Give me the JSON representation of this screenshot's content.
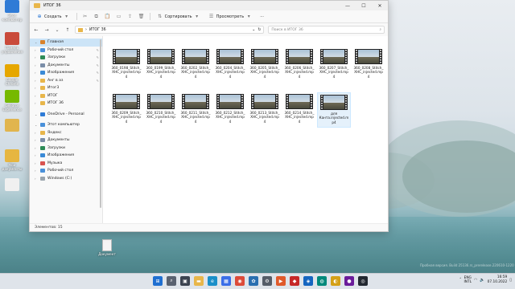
{
  "desktop": {
    "icons": [
      {
        "label": "Этот компьютер",
        "color": "#2f7bd6"
      },
      {
        "label": "Панель управления",
        "color": "#c94a3b"
      },
      {
        "label": "Google Chrome",
        "color": "#e6a700"
      },
      {
        "label": "GeForce Experience",
        "color": "#76b900"
      },
      {
        "label": "",
        "color": "#e1b54e"
      },
      {
        "label": "Мои документы",
        "color": "#e6b640"
      },
      {
        "label": "",
        "color": "#f0f0f0"
      }
    ],
    "doc_label": "Документ"
  },
  "window": {
    "title": "ИТОГ 36",
    "controls": {
      "minimize": "—",
      "maximize": "☐",
      "close": "✕"
    },
    "ribbon": {
      "create_label": "Создать",
      "sort_label": "Сортировать",
      "view_label": "Просмотреть",
      "more_label": "···"
    },
    "address": {
      "path": "ИТОГ 36",
      "search_placeholder": "Поиск в ИТОГ 36"
    },
    "sidebar": {
      "items": [
        {
          "label": "Главная",
          "icon_color": "#d9822b",
          "selected": true,
          "pin": false
        },
        {
          "label": "Рабочий стол",
          "icon_color": "#4a90d9",
          "selected": false,
          "pin": true
        },
        {
          "label": "Загрузки",
          "icon_color": "#2e8b57",
          "selected": false,
          "pin": true
        },
        {
          "label": "Документы",
          "icon_color": "#7b8ea8",
          "selected": false,
          "pin": true
        },
        {
          "label": "Изображения",
          "icon_color": "#3a8ad6",
          "selected": false,
          "pin": true
        },
        {
          "label": "Анг в аз",
          "icon_color": "#e8b64a",
          "selected": false,
          "pin": true
        },
        {
          "label": "Итог3",
          "icon_color": "#e8b64a",
          "selected": false,
          "pin": false
        },
        {
          "label": "ИТОГ",
          "icon_color": "#e8b64a",
          "selected": false,
          "pin": false
        },
        {
          "label": "ИТОГ 36",
          "icon_color": "#e8b64a",
          "selected": false,
          "pin": false
        },
        {
          "label": "",
          "icon_color": "",
          "selected": false,
          "pin": false
        },
        {
          "label": "OneDrive - Personal",
          "icon_color": "#2f7bd6",
          "selected": false,
          "pin": false
        },
        {
          "label": "",
          "icon_color": "",
          "selected": false,
          "pin": false
        },
        {
          "label": "Этот компьютер",
          "icon_color": "#4a90d9",
          "selected": false,
          "pin": false
        },
        {
          "label": "Яндекс",
          "icon_color": "#e8b64a",
          "selected": false,
          "pin": false
        },
        {
          "label": "Документы",
          "icon_color": "#7b8ea8",
          "selected": false,
          "pin": false
        },
        {
          "label": "Загрузки",
          "icon_color": "#2e8b57",
          "selected": false,
          "pin": false
        },
        {
          "label": "Изображения",
          "icon_color": "#3a8ad6",
          "selected": false,
          "pin": false
        },
        {
          "label": "Музыка",
          "icon_color": "#d9534f",
          "selected": false,
          "pin": false
        },
        {
          "label": "Рабочий стол",
          "icon_color": "#4a90d9",
          "selected": false,
          "pin": false
        },
        {
          "label": "Windows (C:)",
          "icon_color": "#9aa4ad",
          "selected": false,
          "pin": false
        }
      ]
    },
    "files": [
      {
        "line1": "360_0198_Stitch_",
        "line2": "XHC_injected.mp",
        "line3": "4"
      },
      {
        "line1": "360_0199_Stitch_",
        "line2": "XHC_injected.mp",
        "line3": "4"
      },
      {
        "line1": "360_0202_Stitch_",
        "line2": "XHC_injected.mp",
        "line3": "4"
      },
      {
        "line1": "360_0204_Stitch_",
        "line2": "XHC_injected.mp",
        "line3": "4"
      },
      {
        "line1": "360_0205_Stitch_",
        "line2": "XHC_injected.mp",
        "line3": "4"
      },
      {
        "line1": "360_0206_Stitch_",
        "line2": "XHC_injected.mp",
        "line3": "4"
      },
      {
        "line1": "360_0207_Stitch_",
        "line2": "XHC_injected.mp",
        "line3": "4"
      },
      {
        "line1": "360_0208_Stitch_",
        "line2": "XHC_injected.mp",
        "line3": "4"
      },
      {
        "line1": "360_0209_Stitch_",
        "line2": "XHC_injected.mp",
        "line3": "4"
      },
      {
        "line1": "360_0210_Stitch_",
        "line2": "XHC_injected.mp",
        "line3": "4"
      },
      {
        "line1": "360_0211_Stitch_",
        "line2": "XHC_injected.mp",
        "line3": "4"
      },
      {
        "line1": "360_0212_Stitch_",
        "line2": "XHC_injected.mp",
        "line3": "4"
      },
      {
        "line1": "360_0213_Stitch_",
        "line2": "XHC_injected.mp",
        "line3": "4"
      },
      {
        "line1": "360_0214_Stitch_",
        "line2": "XHC_injected.mp",
        "line3": "4"
      },
      {
        "line1": "для",
        "line2": "Канта.injected.m",
        "line3": "p4"
      }
    ],
    "status": "Элементов: 15"
  },
  "taskbar": {
    "apps": [
      {
        "name": "start-button",
        "glyph": "⊞",
        "color": "#1f6fd1"
      },
      {
        "name": "search-button",
        "glyph": "⌕",
        "color": "#5a6270"
      },
      {
        "name": "task-view-button",
        "glyph": "▣",
        "color": "#3b4350"
      },
      {
        "name": "explorer-app",
        "glyph": "▬",
        "color": "#e8b64a"
      },
      {
        "name": "edge-app",
        "glyph": "e",
        "color": "#1a8fc9"
      },
      {
        "name": "store-app",
        "glyph": "▦",
        "color": "#3a6ee8"
      },
      {
        "name": "chrome-app",
        "glyph": "◉",
        "color": "#dd4b39"
      },
      {
        "name": "photos-app",
        "glyph": "✿",
        "color": "#2a6fb0"
      },
      {
        "name": "settings-app",
        "glyph": "⚙",
        "color": "#555d68"
      },
      {
        "name": "media-app",
        "glyph": "▶",
        "color": "#e05a2b"
      },
      {
        "name": "app-red",
        "glyph": "◆",
        "color": "#c62828"
      },
      {
        "name": "app-blue",
        "glyph": "◈",
        "color": "#1565c0"
      },
      {
        "name": "app-teal",
        "glyph": "◍",
        "color": "#00897b"
      },
      {
        "name": "app-gold",
        "glyph": "◐",
        "color": "#d4a017"
      },
      {
        "name": "app-purple",
        "glyph": "●",
        "color": "#6a1b9a"
      },
      {
        "name": "app-dark",
        "glyph": "◎",
        "color": "#222831"
      }
    ],
    "lang": {
      "line1": "ENG",
      "line2": "INTL"
    },
    "time": "16:59",
    "date": "07.10.2022"
  },
  "watermark": "Пробная версия. Build 25136.rs_prerelease.220610-1220"
}
